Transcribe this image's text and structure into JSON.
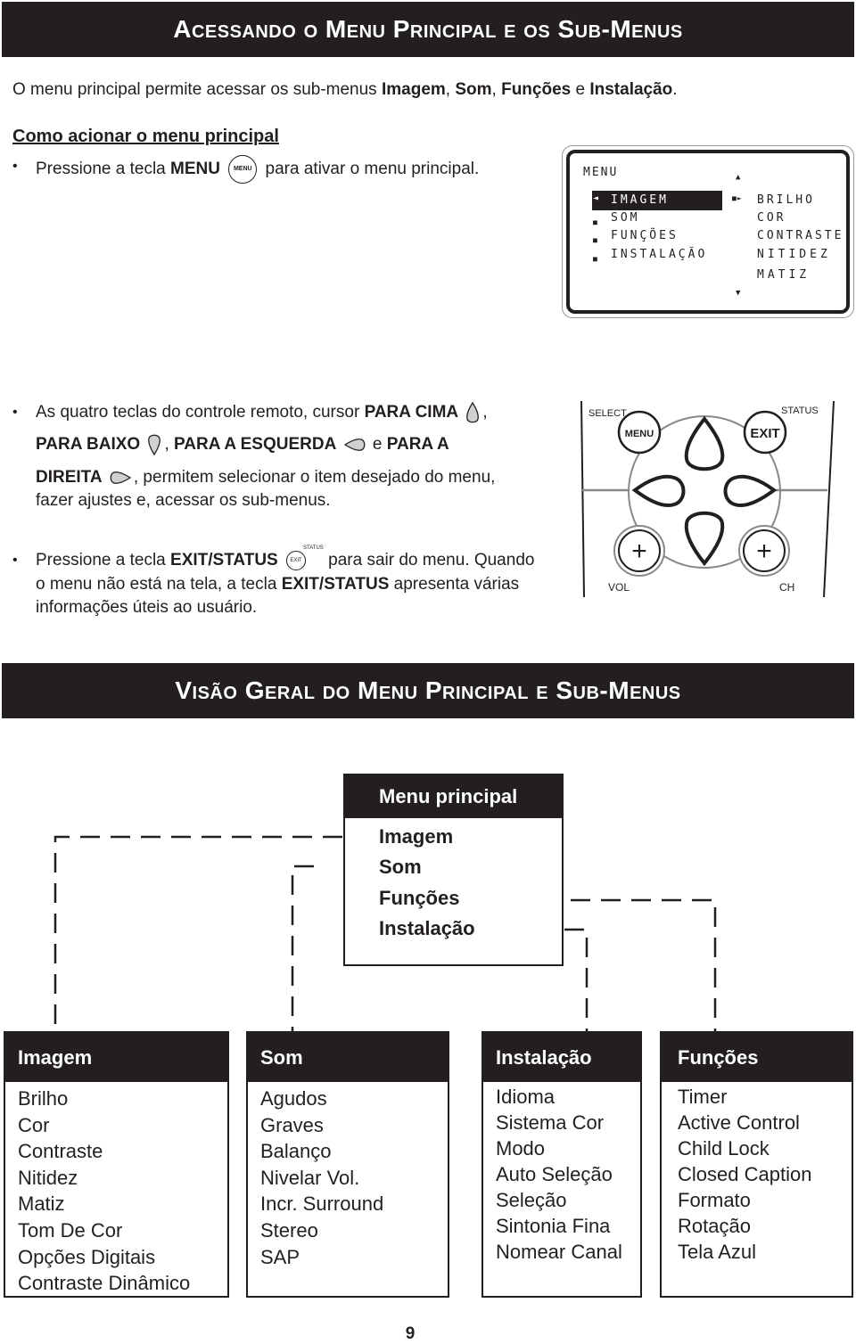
{
  "section1": {
    "title": "Acessando o Menu Principal e os Sub-Menus",
    "intro": {
      "prefix": "O menu principal permite acessar os sub-menus ",
      "items": [
        "Imagem",
        "Som",
        "Funções",
        "Instalação"
      ],
      "sep1": ", ",
      "sep2": ", ",
      "sep3": " e ",
      "suffix": "."
    },
    "subheading": "Como acionar o menu principal",
    "bullet1": {
      "pre": "Pressione a tecla ",
      "key": "MENU",
      "icon_label": "MENU",
      "post": " para ativar o menu principal."
    },
    "bullet2": {
      "line1_pre": "As quatro teclas do controle remoto, cursor ",
      "up": "PARA CIMA",
      "comma": ",",
      "down": "PARA BAIXO",
      "comma2": ", ",
      "left": "PARA A ESQUERDA",
      "and": " e ",
      "right_a": "PARA A",
      "right_b": "DIREITA",
      "line3_post": ", permitem selecionar o item desejado do menu,",
      "line4": "fazer ajustes e, acessar os sub-menus."
    },
    "bullet3": {
      "pre": "Pressione a tecla ",
      "key": "EXIT/STATUS",
      "icon_label": "EXIT",
      "icon_sup": "STATUS",
      "post": " para sair do menu. Quando",
      "line2_pre": "o menu não está na tela, a tecla ",
      "line2_key": "EXIT/STATUS",
      "line2_post": " apresenta várias",
      "line3": "informações úteis ao usuário."
    }
  },
  "tv_screen": {
    "title": "MENU",
    "main_items": [
      "IMAGEM",
      "SOM",
      "FUNÇÕES",
      "INSTALAÇÃO"
    ],
    "selected_index": 0,
    "sub_items": [
      "BRILHO",
      "COR",
      "CONTRASTE",
      "NITIDEZ",
      "MATIZ"
    ]
  },
  "remote": {
    "select_label": "SELECT",
    "menu_button": "MENU",
    "status_label": "STATUS",
    "exit_button": "EXIT",
    "vol_label": "VOL",
    "ch_label": "CH",
    "plus": "+"
  },
  "section2": {
    "title": "Visão Geral do Menu Principal e Sub-Menus",
    "main_menu": {
      "title": "Menu principal",
      "items": [
        "Imagem",
        "Som",
        "Funções",
        "Instalação"
      ]
    },
    "submenus": [
      {
        "title": "Imagem",
        "items": [
          "Brilho",
          "Cor",
          "Contraste",
          "Nitidez",
          "Matiz",
          "Tom De Cor",
          "Opções Digitais",
          "Contraste Dinâmico"
        ]
      },
      {
        "title": "Som",
        "items": [
          "Agudos",
          "Graves",
          "Balanço",
          "Nivelar Vol.",
          "Incr. Surround",
          "Stereo",
          "SAP"
        ]
      },
      {
        "title": "Instalação",
        "items": [
          "Idioma",
          "Sistema Cor",
          "Modo",
          "Auto Seleção",
          "Seleção",
          "Sintonia Fina",
          "Nomear Canal"
        ]
      },
      {
        "title": "Funções",
        "items": [
          "Timer",
          "Active Control",
          "Child Lock",
          "Closed Caption",
          "Formato",
          "Rotação",
          "Tela Azul"
        ]
      }
    ]
  },
  "page_number": "9"
}
